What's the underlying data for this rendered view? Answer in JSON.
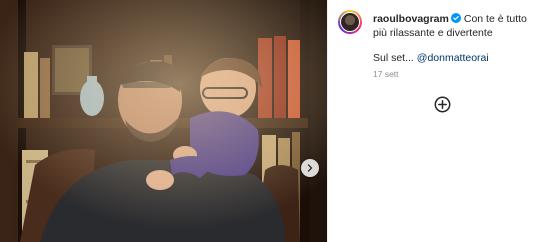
{
  "post": {
    "username": "raoulbovagram",
    "caption_text": "Con te è tutto più rilassante e divertente",
    "caption_second_prefix": "Sul set...",
    "mention": "@donmatteorai",
    "timestamp": "17 sett"
  },
  "icons": {
    "verified": "verified-badge-icon",
    "next": "chevron-right-icon",
    "add": "add-circle-icon"
  },
  "colors": {
    "verified_blue": "#0095f6",
    "mention_link": "#00376b",
    "meta_gray": "#8e8e8e"
  }
}
